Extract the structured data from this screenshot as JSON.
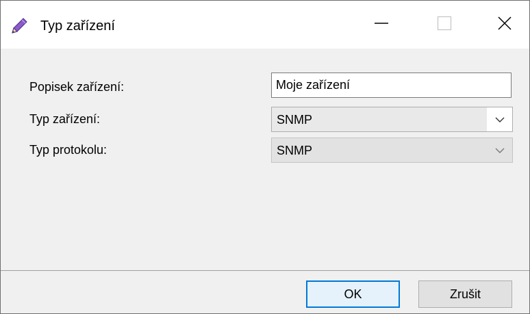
{
  "window": {
    "title": "Typ zařízení",
    "icon": "pencil-icon"
  },
  "caption_buttons": {
    "minimize": "minimize-icon",
    "maximize": "maximize-icon",
    "close": "close-icon"
  },
  "form": {
    "device_label": {
      "label": "Popisek zařízení:",
      "value": "Moje zařízení"
    },
    "device_type": {
      "label": "Typ zařízení:",
      "value": "SNMP"
    },
    "protocol_type": {
      "label": "Typ protokolu:",
      "value": "SNMP",
      "disabled": true
    }
  },
  "buttons": {
    "ok": "OK",
    "cancel": "Zrušit"
  },
  "colors": {
    "accent": "#0078d7",
    "window_bg": "#f0f0f0",
    "titlebar_bg": "#ffffff"
  }
}
